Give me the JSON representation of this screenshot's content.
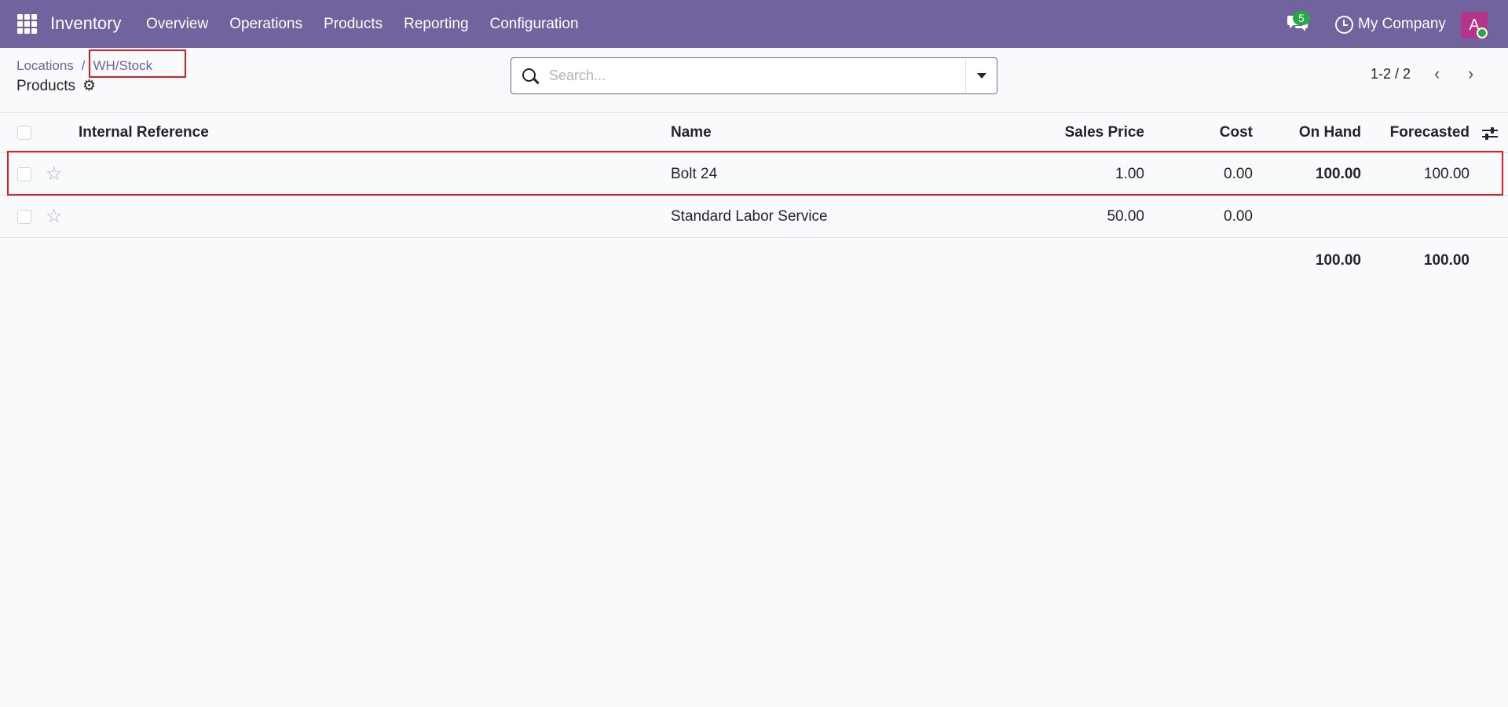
{
  "navbar": {
    "app_name": "Inventory",
    "menu": [
      "Overview",
      "Operations",
      "Products",
      "Reporting",
      "Configuration"
    ],
    "chat_count": "5",
    "company": "My Company",
    "avatar_letter": "A"
  },
  "breadcrumb": {
    "parent": "Locations",
    "separator": "/",
    "current": "WH/Stock"
  },
  "page_title": "Products",
  "search": {
    "placeholder": "Search..."
  },
  "pager": {
    "range": "1-2 / 2",
    "prev": "‹",
    "next": "›"
  },
  "table": {
    "headers": {
      "internal_reference": "Internal Reference",
      "name": "Name",
      "sales_price": "Sales Price",
      "cost": "Cost",
      "on_hand": "On Hand",
      "forecasted": "Forecasted"
    },
    "rows": [
      {
        "internal_reference": "",
        "name": "Bolt 24",
        "sales_price": "1.00",
        "cost": "0.00",
        "on_hand": "100.00",
        "forecasted": "100.00"
      },
      {
        "internal_reference": "",
        "name": "Standard Labor Service",
        "sales_price": "50.00",
        "cost": "0.00",
        "on_hand": "",
        "forecasted": ""
      }
    ],
    "totals": {
      "on_hand": "100.00",
      "forecasted": "100.00"
    }
  },
  "colors": {
    "navbar": "#71639e",
    "link": "#71639e",
    "highlight": "#e31b23",
    "badge": "#28a745",
    "avatar": "#b5348a"
  }
}
